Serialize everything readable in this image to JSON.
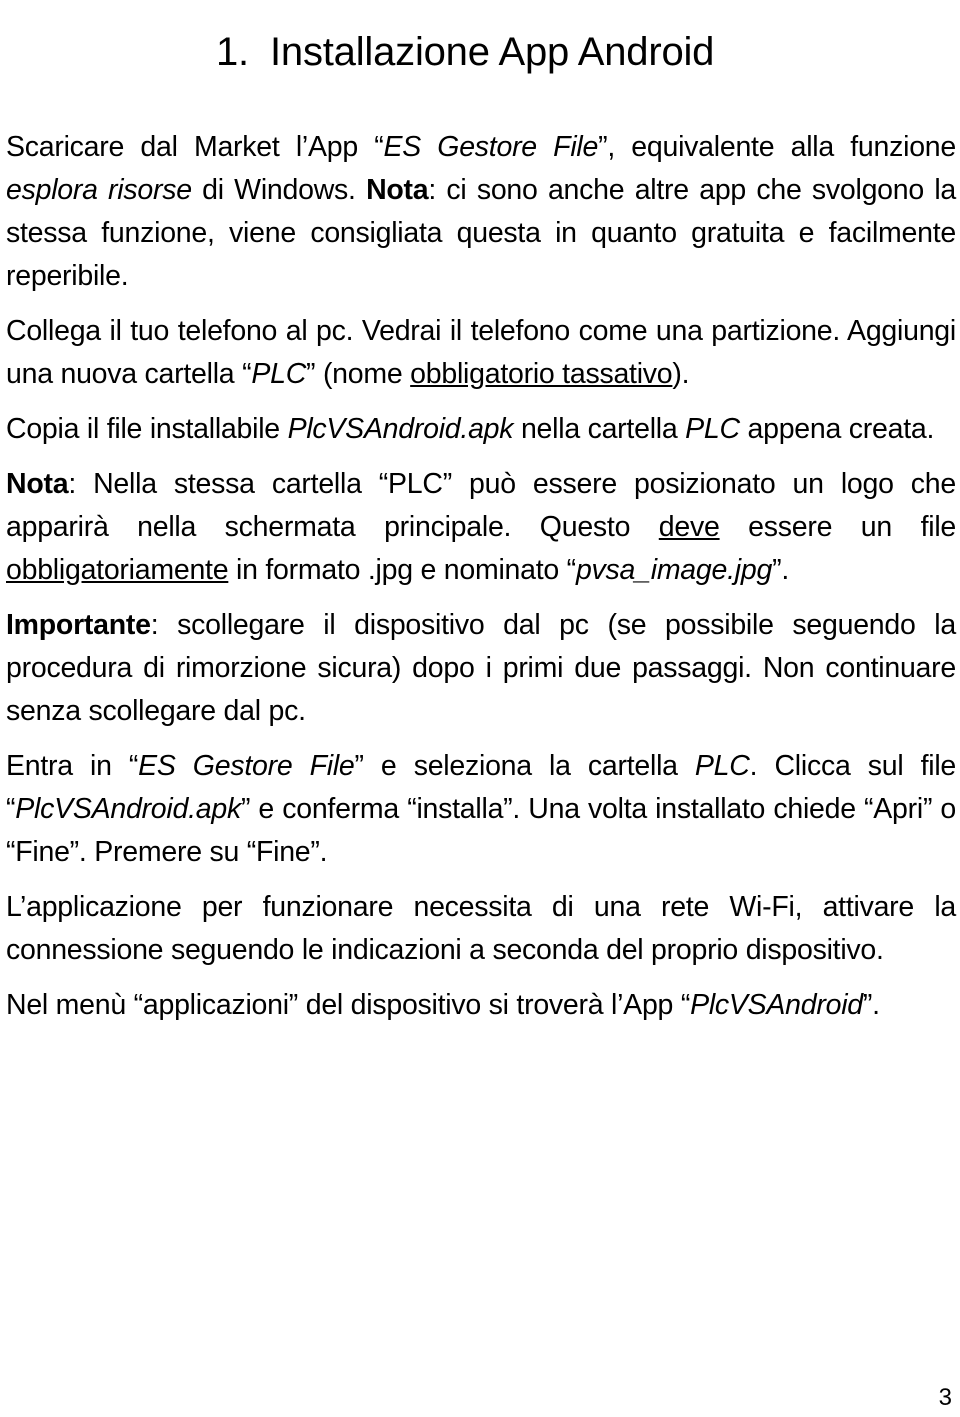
{
  "document": {
    "title_number": "1.",
    "title_text": "Installazione App Android",
    "page_number": "3",
    "paragraphs": [
      {
        "id": "p1",
        "runs": [
          {
            "text": "Scaricare dal Market l’App “",
            "style": "normal"
          },
          {
            "text": "ES Gestore File",
            "style": "italic"
          },
          {
            "text": "”, equivalente alla funzione ",
            "style": "normal"
          },
          {
            "text": "esplora risorse",
            "style": "italic"
          },
          {
            "text": " di Windows. ",
            "style": "normal"
          },
          {
            "text": "Nota",
            "style": "bold"
          },
          {
            "text": ": ci sono anche altre app che svolgono la stessa funzione, viene consigliata questa in quanto gratuita e facilmente reperibile.",
            "style": "normal"
          }
        ],
        "plain": "Scaricare dal Market l’App “ES Gestore File”, equivalente alla funzione esplora risorse di Windows. Nota: ci sono anche altre app che svolgono la stessa funzione, viene consigliata questa in quanto gratuita e facilmente reperibile."
      },
      {
        "id": "p2",
        "runs": [
          {
            "text": "Collega il tuo telefono al pc. Vedrai il telefono come una partizione. Aggiungi una nuova cartella “",
            "style": "normal"
          },
          {
            "text": "PLC",
            "style": "italic"
          },
          {
            "text": "” (nome ",
            "style": "normal"
          },
          {
            "text": "obbligatorio tassativo",
            "style": "underline"
          },
          {
            "text": ").",
            "style": "normal"
          }
        ],
        "plain": "Collega il tuo telefono al pc. Vedrai il telefono come una partizione. Aggiungi una nuova cartella “PLC” (nome obbligatorio tassativo)."
      },
      {
        "id": "p3",
        "runs": [
          {
            "text": "Copia il file installabile ",
            "style": "normal"
          },
          {
            "text": "PlcVSAndroid.apk",
            "style": "italic"
          },
          {
            "text": " nella cartella ",
            "style": "normal"
          },
          {
            "text": "PLC",
            "style": "italic"
          },
          {
            "text": " appena creata.",
            "style": "normal"
          }
        ],
        "plain": "Copia il file installabile PlcVSAndroid.apk nella cartella PLC appena creata."
      },
      {
        "id": "p4",
        "runs": [
          {
            "text": "Nota",
            "style": "bold"
          },
          {
            "text": ": Nella stessa cartella “PLC” può essere posizionato un logo che apparirà nella schermata principale. Questo ",
            "style": "normal"
          },
          {
            "text": "deve",
            "style": "underline"
          },
          {
            "text": " essere un file ",
            "style": "normal"
          },
          {
            "text": "obbligatoriamente",
            "style": "underline"
          },
          {
            "text": " in formato .jpg e nominato “",
            "style": "normal"
          },
          {
            "text": "pvsa_image.jpg",
            "style": "italic"
          },
          {
            "text": "”.",
            "style": "normal"
          }
        ],
        "plain": "Nota: Nella stessa cartella “PLC” può essere posizionato un logo che apparirà nella schermata principale. Questo deve essere un file obbligatoriamente in formato .jpg e nominato “pvsa_image.jpg”."
      },
      {
        "id": "p5",
        "runs": [
          {
            "text": "Importante",
            "style": "bold"
          },
          {
            "text": ": scollegare il dispositivo dal pc (se possibile seguendo la procedura di rimorzione sicura) dopo i primi due passaggi. Non continuare senza scollegare dal pc.",
            "style": "normal"
          }
        ],
        "plain": "Importante: scollegare il dispositivo dal pc (se possibile seguendo la procedura di rimorzione sicura) dopo i primi due passaggi. Non continuare senza scollegare dal pc."
      },
      {
        "id": "p6",
        "runs": [
          {
            "text": "Entra in “",
            "style": "normal"
          },
          {
            "text": "ES Gestore File",
            "style": "italic"
          },
          {
            "text": "” e seleziona la cartella ",
            "style": "normal"
          },
          {
            "text": "PLC",
            "style": "italic"
          },
          {
            "text": ". Clicca sul file “",
            "style": "normal"
          },
          {
            "text": "PlcVSAndroid.apk",
            "style": "italic"
          },
          {
            "text": "” e conferma “installa”. Una volta installato chiede “Apri” o “Fine”. Premere su “Fine”.",
            "style": "normal"
          }
        ],
        "plain": "Entra in “ES Gestore File” e seleziona la cartella PLC. Clicca sul file “PlcVSAndroid.apk” e conferma “installa”. Una volta installato chiede “Apri” o “Fine”. Premere su “Fine”."
      },
      {
        "id": "p7",
        "runs": [
          {
            "text": "L’applicazione per funzionare necessita di una rete Wi-Fi, attivare la connessione seguendo le indicazioni a seconda del proprio dispositivo.",
            "style": "normal"
          }
        ],
        "plain": "L’applicazione per funzionare necessita di una rete Wi-Fi, attivare la connessione seguendo le indicazioni a seconda del proprio dispositivo."
      },
      {
        "id": "p8",
        "runs": [
          {
            "text": "Nel menù “applicazioni” del dispositivo si troverà l’App “",
            "style": "normal"
          },
          {
            "text": "PlcVSAndroid",
            "style": "italic"
          },
          {
            "text": "”.",
            "style": "normal"
          }
        ],
        "plain": "Nel menù “applicazioni” del dispositivo si troverà l’App “PlcVSAndroid”."
      }
    ]
  }
}
